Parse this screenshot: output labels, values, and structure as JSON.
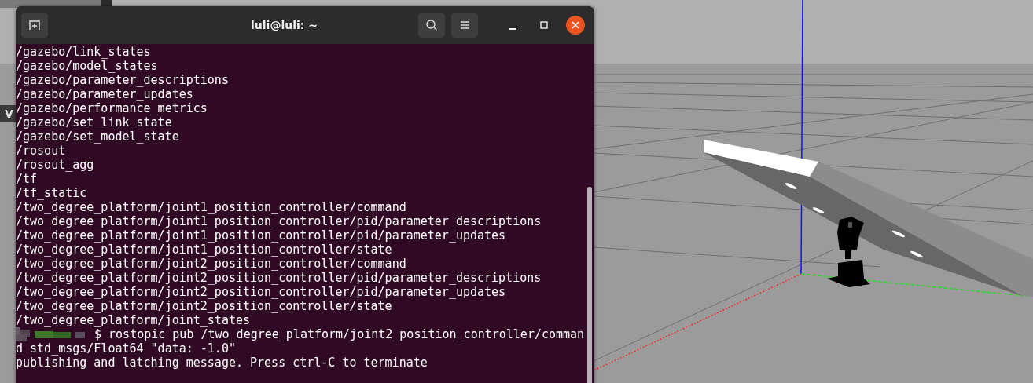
{
  "background_window": {
    "label": "V"
  },
  "terminal": {
    "title": "luli@luli: ~",
    "lines": [
      {
        "kind": "output",
        "text": "/gazebo/link_states"
      },
      {
        "kind": "output",
        "text": "/gazebo/model_states"
      },
      {
        "kind": "output",
        "text": "/gazebo/parameter_descriptions"
      },
      {
        "kind": "output",
        "text": "/gazebo/parameter_updates"
      },
      {
        "kind": "output",
        "text": "/gazebo/performance_metrics"
      },
      {
        "kind": "output",
        "text": "/gazebo/set_link_state"
      },
      {
        "kind": "output",
        "text": "/gazebo/set_model_state"
      },
      {
        "kind": "output",
        "text": "/rosout"
      },
      {
        "kind": "output",
        "text": "/rosout_agg"
      },
      {
        "kind": "output",
        "text": "/tf"
      },
      {
        "kind": "output",
        "text": "/tf_static"
      },
      {
        "kind": "output",
        "text": "/two_degree_platform/joint1_position_controller/command"
      },
      {
        "kind": "output",
        "text": "/two_degree_platform/joint1_position_controller/pid/parameter_descriptions"
      },
      {
        "kind": "output",
        "text": "/two_degree_platform/joint1_position_controller/pid/parameter_updates"
      },
      {
        "kind": "output",
        "text": "/two_degree_platform/joint1_position_controller/state"
      },
      {
        "kind": "output",
        "text": "/two_degree_platform/joint2_position_controller/command"
      },
      {
        "kind": "output",
        "text": "/two_degree_platform/joint2_position_controller/pid/parameter_descriptions"
      },
      {
        "kind": "output",
        "text": "/two_degree_platform/joint2_position_controller/pid/parameter_updates"
      },
      {
        "kind": "output",
        "text": "/two_degree_platform/joint2_position_controller/state"
      },
      {
        "kind": "output",
        "text": "/two_degree_platform/joint_states"
      },
      {
        "kind": "prompt",
        "text": "$ rostopic pub /two_degree_platform/joint2_position_controller/comman"
      },
      {
        "kind": "output",
        "text": "d std_msgs/Float64 \"data: -1.0\""
      },
      {
        "kind": "output",
        "text": "publishing and latching message. Press ctrl-C to terminate"
      }
    ]
  }
}
